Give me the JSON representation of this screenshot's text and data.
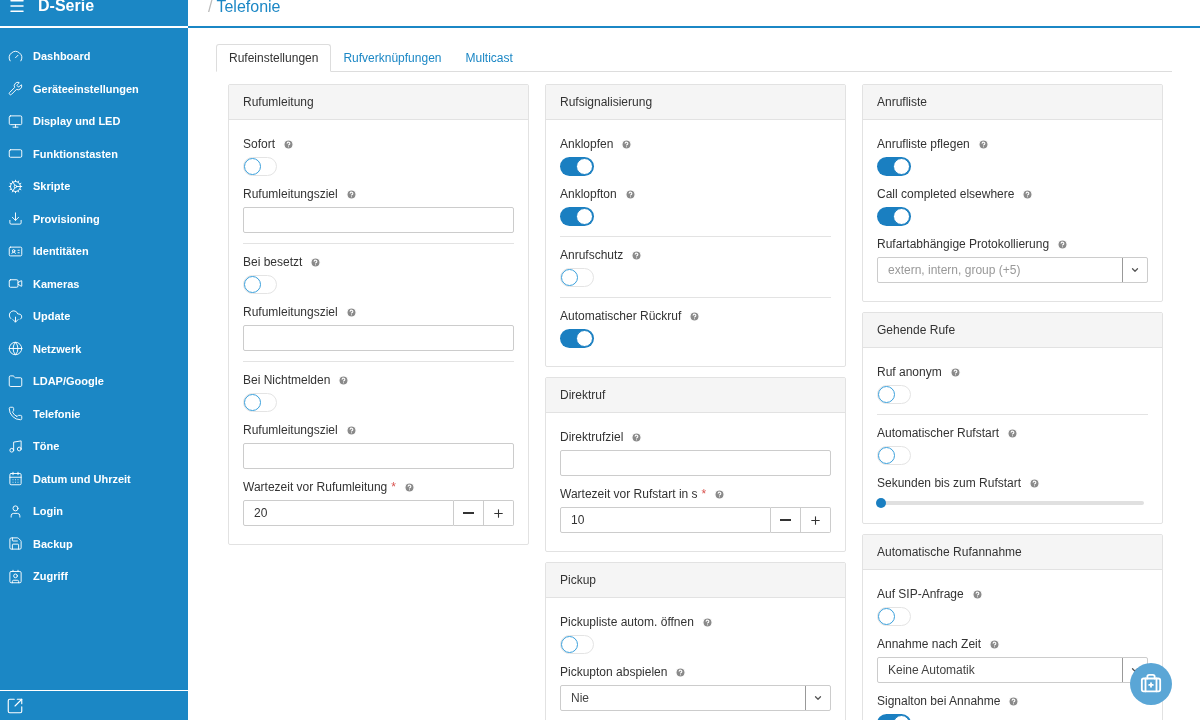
{
  "sidebar": {
    "title": "D-Serie",
    "items": [
      {
        "label": "Dashboard"
      },
      {
        "label": "Geräteeinstellungen"
      },
      {
        "label": "Display und LED"
      },
      {
        "label": "Funktionstasten"
      },
      {
        "label": "Skripte"
      },
      {
        "label": "Provisioning"
      },
      {
        "label": "Identitäten"
      },
      {
        "label": "Kameras"
      },
      {
        "label": "Update"
      },
      {
        "label": "Netzwerk"
      },
      {
        "label": "LDAP/Google"
      },
      {
        "label": "Telefonie"
      },
      {
        "label": "Töne"
      },
      {
        "label": "Datum und Uhrzeit"
      },
      {
        "label": "Login"
      },
      {
        "label": "Backup"
      },
      {
        "label": "Zugriff"
      }
    ]
  },
  "breadcrumb": {
    "separator": "/",
    "title": "Telefonie"
  },
  "tabs": [
    {
      "label": "Rufeinstellungen",
      "selected": true
    },
    {
      "label": "Rufverknüpfungen",
      "selected": false
    },
    {
      "label": "Multicast",
      "selected": false
    }
  ],
  "columns": [
    [
      {
        "title": "Rufumleitung",
        "items": [
          {
            "kind": "toggle",
            "label": "Sofort",
            "on": false
          },
          {
            "kind": "text",
            "label": "Rufumleitungsziel"
          },
          {
            "kind": "divider"
          },
          {
            "kind": "toggle",
            "label": "Bei besetzt",
            "on": false
          },
          {
            "kind": "text",
            "label": "Rufumleitungsziel"
          },
          {
            "kind": "divider"
          },
          {
            "kind": "toggle",
            "label": "Bei Nichtmelden",
            "on": false
          },
          {
            "kind": "text",
            "label": "Rufumleitungsziel"
          },
          {
            "kind": "stepper",
            "label": "Wartezeit vor Rufumleitung",
            "required": "*",
            "value": "20"
          }
        ]
      }
    ],
    [
      {
        "title": "Rufsignalisierung",
        "items": [
          {
            "kind": "toggle",
            "label": "Anklopfen",
            "on": true
          },
          {
            "kind": "toggle",
            "label": "Anklopfton",
            "on": true
          },
          {
            "kind": "divider"
          },
          {
            "kind": "toggle",
            "label": "Anrufschutz",
            "on": false
          },
          {
            "kind": "divider"
          },
          {
            "kind": "toggle",
            "label": "Automatischer Rückruf",
            "on": true
          }
        ]
      },
      {
        "title": "Direktruf",
        "items": [
          {
            "kind": "text",
            "label": "Direktrufziel"
          },
          {
            "kind": "stepper",
            "label": "Wartezeit vor Rufstart in s",
            "required": "*",
            "value": "10"
          }
        ]
      },
      {
        "title": "Pickup",
        "items": [
          {
            "kind": "toggle",
            "label": "Pickupliste autom. öffnen",
            "on": false
          },
          {
            "kind": "select",
            "label": "Pickupton abspielen",
            "value": "Nie"
          }
        ]
      }
    ],
    [
      {
        "title": "Anrufliste",
        "items": [
          {
            "kind": "toggle",
            "label": "Anrufliste pflegen",
            "on": true
          },
          {
            "kind": "toggle",
            "label": "Call completed elsewhere",
            "on": true
          },
          {
            "kind": "select",
            "label": "Rufartabhängige Protokollierung",
            "placeholder": "extern, intern, group (+5)"
          }
        ]
      },
      {
        "title": "Gehende Rufe",
        "items": [
          {
            "kind": "toggle",
            "label": "Ruf anonym",
            "on": false
          },
          {
            "kind": "divider"
          },
          {
            "kind": "toggle",
            "label": "Automatischer Rufstart",
            "on": false
          },
          {
            "kind": "slider",
            "label": "Sekunden bis zum Rufstart",
            "level": 0
          }
        ]
      },
      {
        "title": "Automatische Rufannahme",
        "items": [
          {
            "kind": "toggle",
            "label": "Auf SIP-Anfrage",
            "on": false
          },
          {
            "kind": "select",
            "label": "Annahme nach Zeit",
            "value": "Keine Automatik"
          },
          {
            "kind": "toggle",
            "label": "Signalton bei Annahme",
            "on": true
          }
        ]
      }
    ]
  ]
}
